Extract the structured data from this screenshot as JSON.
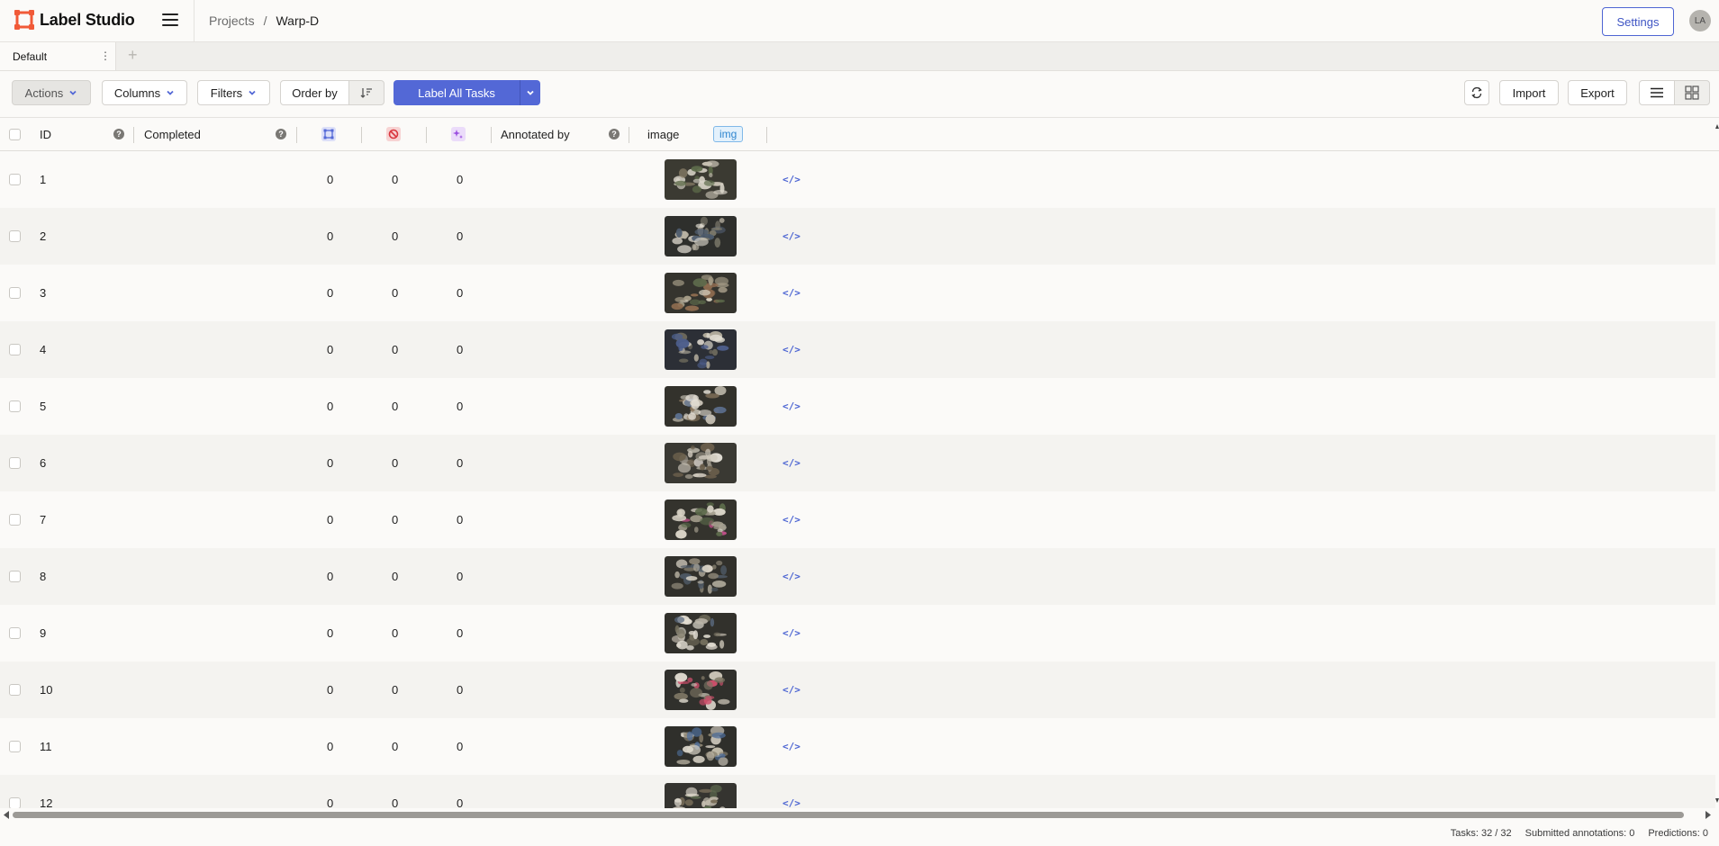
{
  "app": {
    "name": "Label Studio",
    "avatar_initials": "LA"
  },
  "header": {
    "breadcrumb": [
      "Projects",
      "/",
      "Warp-D"
    ],
    "settings_label": "Settings"
  },
  "tabs": [
    {
      "label": "Default"
    }
  ],
  "toolbar": {
    "actions_label": "Actions",
    "columns_label": "Columns",
    "filters_label": "Filters",
    "order_by_label": "Order by",
    "label_all_label": "Label All Tasks",
    "import_label": "Import",
    "export_label": "Export"
  },
  "table": {
    "columns": {
      "id": "ID",
      "completed": "Completed",
      "annotated_by": "Annotated by",
      "image": "image",
      "image_tag": "img"
    },
    "rows": [
      {
        "id": "1",
        "total": "0",
        "cancelled": "0",
        "predictions": "0"
      },
      {
        "id": "2",
        "total": "0",
        "cancelled": "0",
        "predictions": "0"
      },
      {
        "id": "3",
        "total": "0",
        "cancelled": "0",
        "predictions": "0"
      },
      {
        "id": "4",
        "total": "0",
        "cancelled": "0",
        "predictions": "0"
      },
      {
        "id": "5",
        "total": "0",
        "cancelled": "0",
        "predictions": "0"
      },
      {
        "id": "6",
        "total": "0",
        "cancelled": "0",
        "predictions": "0"
      },
      {
        "id": "7",
        "total": "0",
        "cancelled": "0",
        "predictions": "0"
      },
      {
        "id": "8",
        "total": "0",
        "cancelled": "0",
        "predictions": "0"
      },
      {
        "id": "9",
        "total": "0",
        "cancelled": "0",
        "predictions": "0"
      },
      {
        "id": "10",
        "total": "0",
        "cancelled": "0",
        "predictions": "0"
      },
      {
        "id": "11",
        "total": "0",
        "cancelled": "0",
        "predictions": "0"
      },
      {
        "id": "12",
        "total": "0",
        "cancelled": "0",
        "predictions": "0"
      }
    ]
  },
  "footer": {
    "tasks": "Tasks: 32 / 32",
    "submitted": "Submitted annotations: 0",
    "predictions": "Predictions: 0"
  },
  "colors": {
    "accent": "#5368d6",
    "logo": "#f15a38"
  }
}
